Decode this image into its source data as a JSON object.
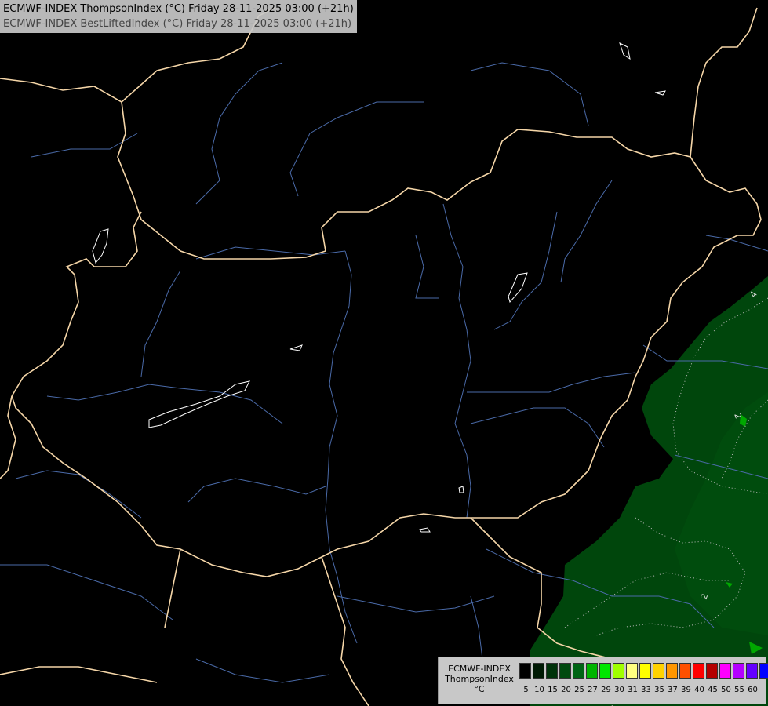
{
  "header": {
    "line1": "ECMWF-INDEX ThompsonIndex (°C) Friday 28-11-2025 03:00 (+21h)",
    "line2": "ECMWF-INDEX BestLiftedIndex (°C) Friday 28-11-2025 03:00 (+21h)"
  },
  "map": {
    "contour_labels": [
      "4",
      "2",
      "2"
    ],
    "colors": {
      "background": "#000000",
      "border": "#f5d6a8",
      "river": "#4a6aa8",
      "lake": "#ffffff",
      "fill_15": "#00460c",
      "fill_20": "#005a10",
      "contour": "#bdbdbd"
    }
  },
  "legend": {
    "line1": "ECMWF-INDEX",
    "line2": "ThompsonIndex",
    "line3": "°C",
    "ticks": [
      "5",
      "10",
      "15",
      "20",
      "25",
      "27",
      "29",
      "30",
      "31",
      "33",
      "35",
      "37",
      "39",
      "40",
      "45",
      "50",
      "55",
      "60"
    ],
    "colors": [
      "#000000",
      "#001a04",
      "#00330a",
      "#004a0e",
      "#006414",
      "#00b400",
      "#00e600",
      "#a0ff00",
      "#ffff80",
      "#ffff00",
      "#ffd200",
      "#ff9600",
      "#ff5000",
      "#ff0000",
      "#b40000",
      "#ff00ff",
      "#b400ff",
      "#6400ff",
      "#0000ff"
    ]
  }
}
